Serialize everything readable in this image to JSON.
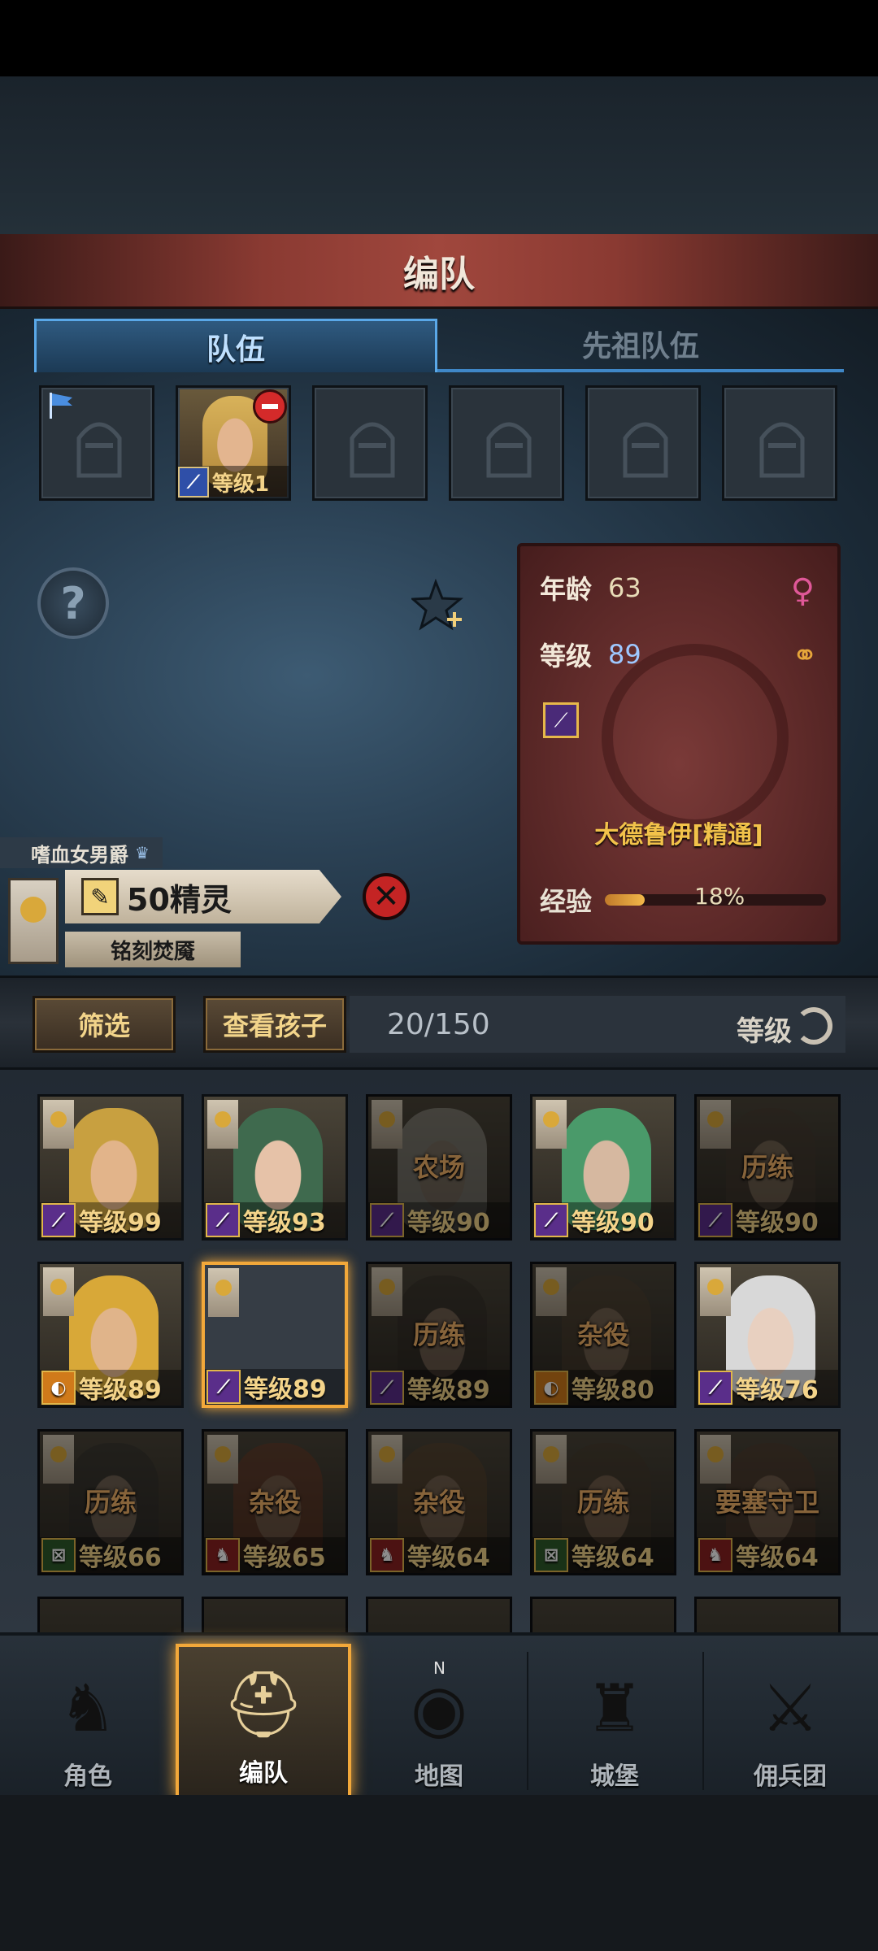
{
  "header": {
    "title": "编队"
  },
  "tabs": [
    {
      "label": "队伍",
      "active": true
    },
    {
      "label": "先祖队伍",
      "active": false
    }
  ],
  "team_slots": {
    "hero_level": "等级1"
  },
  "info_card": {
    "age_label": "年龄",
    "age_value": "63",
    "level_label": "等级",
    "level_value": "89",
    "class_name": "大德鲁伊[精通]",
    "exp_label": "经验",
    "exp_percent_text": "18%",
    "exp_fraction": 0.18
  },
  "hero_banner": {
    "noble_title": "嗜血女男爵",
    "race": "50精灵",
    "subtitle": "铭刻焚魇"
  },
  "filter_bar": {
    "filter_label": "筛选",
    "children_label": "查看孩子",
    "count": "20/150",
    "sort_label": "等级"
  },
  "roster": [
    {
      "level": "等级99",
      "job": "",
      "icon": "mage-staff-icon",
      "dim": false,
      "selected": false,
      "skin": "#e2b48a",
      "hair": "#c8a040"
    },
    {
      "level": "等级93",
      "job": "",
      "icon": "mage-staff-icon",
      "dim": false,
      "selected": false,
      "skin": "#e6c2a8",
      "hair": "#3f6a4e"
    },
    {
      "level": "等级90",
      "job": "农场",
      "icon": "mage-staff-icon",
      "dim": true,
      "selected": false,
      "skin": "#d8c4b0",
      "hair": "#d8d8d0"
    },
    {
      "level": "等级90",
      "job": "",
      "icon": "mage-staff-icon",
      "dim": false,
      "selected": false,
      "skin": "#d6b8a0",
      "hair": "#4a9a6a"
    },
    {
      "level": "等级90",
      "job": "历练",
      "icon": "mage-staff-icon",
      "dim": true,
      "selected": false,
      "skin": "#c8a88a",
      "hair": "#4a3a30"
    },
    {
      "level": "等级89",
      "job": "",
      "icon": "shield-icon",
      "dim": false,
      "selected": false,
      "skin": "#e0b48a",
      "hair": "#d8a838"
    },
    {
      "level": "等级89",
      "job": "",
      "icon": "mage-staff-icon",
      "dim": false,
      "selected": true,
      "skin": "",
      "hair": ""
    },
    {
      "level": "等级89",
      "job": "历练",
      "icon": "mage-staff-icon",
      "dim": true,
      "selected": false,
      "skin": "#caa48a",
      "hair": "#2a2420"
    },
    {
      "level": "等级80",
      "job": "杂役",
      "icon": "shield-icon",
      "dim": true,
      "selected": false,
      "skin": "#d0a888",
      "hair": "#5a4630"
    },
    {
      "level": "等级76",
      "job": "",
      "icon": "mage-staff-icon",
      "dim": false,
      "selected": false,
      "skin": "#e8d0c0",
      "hair": "#d8d8d8"
    },
    {
      "level": "等级66",
      "job": "历练",
      "icon": "bow-icon",
      "dim": true,
      "selected": false,
      "skin": "#c8a890",
      "hair": "#2a2a2a"
    },
    {
      "level": "等级65",
      "job": "杂役",
      "icon": "horse-icon",
      "dim": true,
      "selected": false,
      "skin": "#c89070",
      "hair": "#8a3a20"
    },
    {
      "level": "等级64",
      "job": "杂役",
      "icon": "horse-icon",
      "dim": true,
      "selected": false,
      "skin": "#caa080",
      "hair": "#6a4a2a"
    },
    {
      "level": "等级64",
      "job": "历练",
      "icon": "bow-icon",
      "dim": true,
      "selected": false,
      "skin": "#c89a78",
      "hair": "#4a3a2a"
    },
    {
      "level": "等级64",
      "job": "要塞守卫",
      "icon": "horse-icon",
      "dim": true,
      "selected": false,
      "skin": "#c89a7a",
      "hair": "#5a3a2a"
    }
  ],
  "nav": [
    {
      "label": "角色",
      "icon": "knight-icon",
      "active": false
    },
    {
      "label": "编队",
      "icon": "helmet-icon",
      "active": true
    },
    {
      "label": "地图",
      "icon": "compass-map-icon",
      "active": false
    },
    {
      "label": "城堡",
      "icon": "castle-icon",
      "active": false
    },
    {
      "label": "佣兵团",
      "icon": "mercenary-icon",
      "active": false
    }
  ],
  "compass_letter": "N",
  "colors": {
    "accent_orange": "#f2a83a",
    "tab_blue": "#5aa8e8",
    "banner_red": "#a0473d",
    "card_red": "#5e2a29"
  }
}
